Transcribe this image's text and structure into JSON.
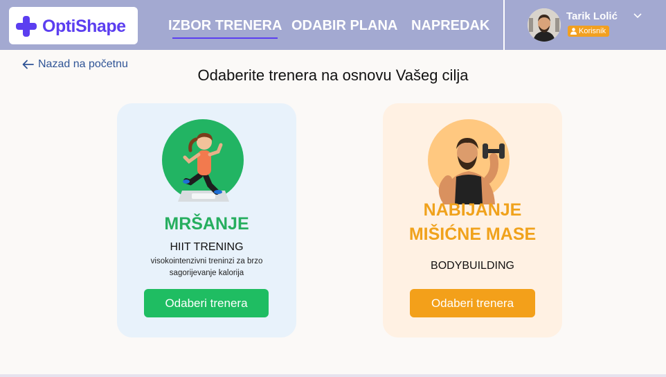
{
  "app": {
    "name": "OptiShape"
  },
  "nav": {
    "links": [
      {
        "label": "IZBOR TRENERA",
        "active": true
      },
      {
        "label": "ODABIR PLANA",
        "active": false
      },
      {
        "label": "NAPREDAK",
        "active": false
      }
    ]
  },
  "user": {
    "name": "Tarik Lolić",
    "role": "Korisnik"
  },
  "back_link": {
    "label": "Nazad na početnu"
  },
  "page_title": "Odaberite trenera na osnovu Vašeg cilja",
  "cards": [
    {
      "title": "MRŠANJE",
      "subtitle": "HIIT TRENING",
      "description": "visokointenzivni treninzi za brzo sagorijevanje kalorija",
      "button": "Odaberi trenera",
      "accent": "#26ae5f",
      "button_color": "#1fbd62",
      "illustration": "running-woman-on-scale-icon"
    },
    {
      "title_line1": "NABIJANJE",
      "title_line2": "MIŠIĆNE MASE",
      "subtitle": "BODYBUILDING",
      "button": "Odaberi trenera",
      "accent": "#f0a21c",
      "button_color": "#f3a01a",
      "illustration": "bodybuilder-with-dumbbell-icon"
    }
  ],
  "colors": {
    "navbar": "#a3a9d1",
    "brand": "#5b3ef0",
    "badge": "#f2a020"
  }
}
